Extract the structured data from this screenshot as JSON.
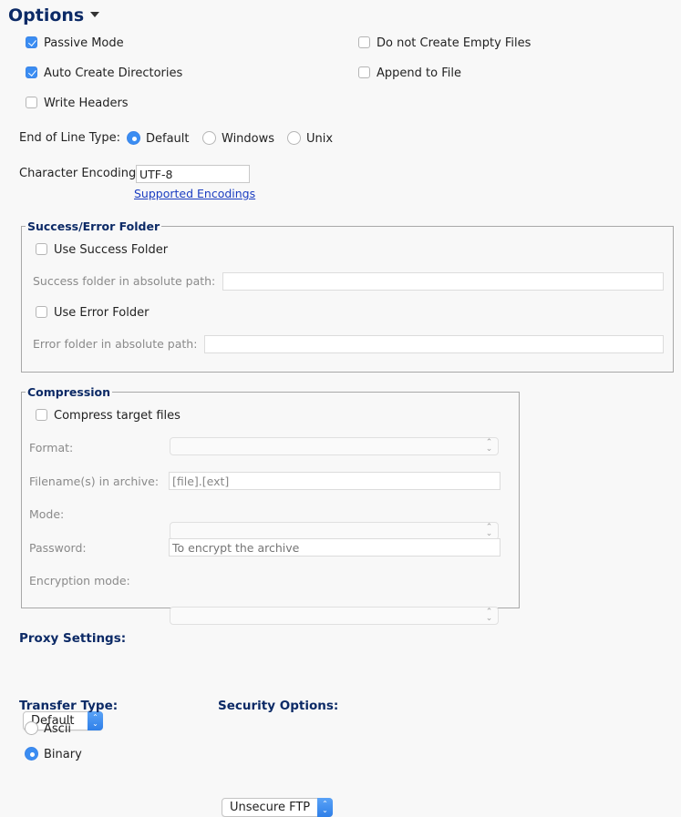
{
  "options": {
    "title": "Options",
    "checkboxes_left": [
      {
        "label": "Passive Mode",
        "checked": true
      },
      {
        "label": "Auto Create Directories",
        "checked": true
      },
      {
        "label": "Write Headers",
        "checked": false
      }
    ],
    "checkboxes_right": [
      {
        "label": "Do not Create Empty Files",
        "checked": false
      },
      {
        "label": "Append to File",
        "checked": false
      }
    ],
    "end_of_line": {
      "label": "End of Line Type:",
      "options": [
        {
          "label": "Default",
          "selected": true
        },
        {
          "label": "Windows",
          "selected": false
        },
        {
          "label": "Unix",
          "selected": false
        }
      ]
    },
    "encoding": {
      "label": "Character Encoding:",
      "value": "UTF-8",
      "link": "Supported Encodings"
    }
  },
  "success_error": {
    "legend": "Success/Error Folder",
    "use_success": {
      "label": "Use Success Folder",
      "checked": false
    },
    "success_path_label": "Success folder in absolute path:",
    "success_path_value": "",
    "use_error": {
      "label": "Use Error Folder",
      "checked": false
    },
    "error_path_label": "Error folder in absolute path:",
    "error_path_value": ""
  },
  "compression": {
    "legend": "Compression",
    "compress": {
      "label": "Compress target files",
      "checked": false
    },
    "format_label": "Format:",
    "format_value": "",
    "filenames_label": "Filename(s) in archive:",
    "filenames_value": "[file].[ext]",
    "mode_label": "Mode:",
    "mode_value": "",
    "password_label": "Password:",
    "password_placeholder": "To encrypt the archive",
    "encryption_label": "Encryption mode:",
    "encryption_value": ""
  },
  "proxy": {
    "title": "Proxy Settings:",
    "value": "Default"
  },
  "transfer": {
    "title": "Transfer Type:",
    "options": [
      {
        "label": "Ascii",
        "selected": false
      },
      {
        "label": "Binary",
        "selected": true
      }
    ]
  },
  "security": {
    "title": "Security Options:",
    "value": "Unsecure FTP"
  },
  "icons": {
    "updown": "⌃⌄"
  }
}
